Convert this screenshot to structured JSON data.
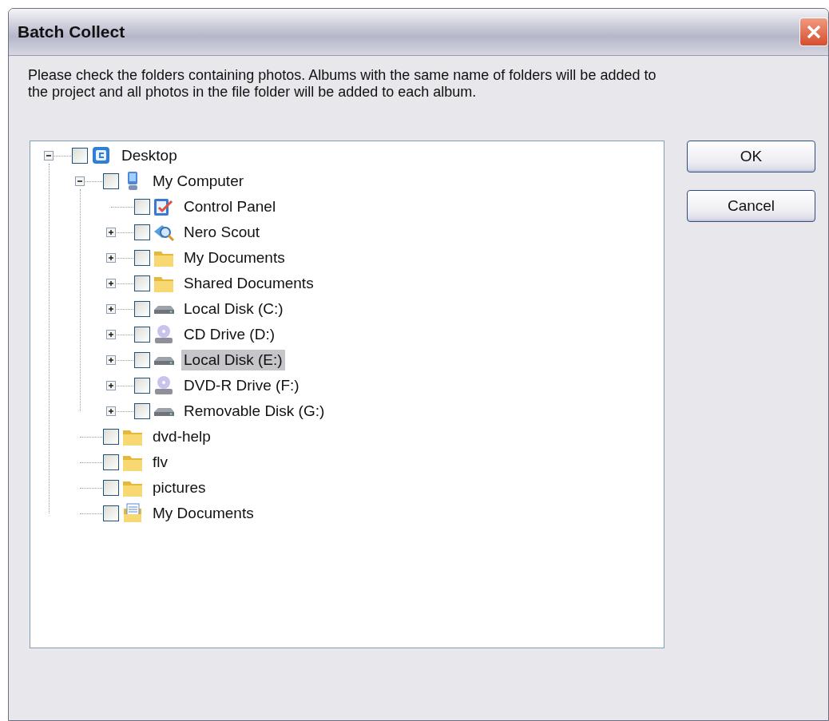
{
  "window": {
    "title": "Batch Collect"
  },
  "description": "Please check the folders containing photos. Albums with the same name of folders will be added to the project and all photos in the file folder will be added to each album.",
  "tree": [
    {
      "label": "Desktop",
      "kind": "desktop",
      "checked": false,
      "expanded": true,
      "selected": false,
      "children": [
        {
          "label": "My Computer",
          "kind": "computer",
          "checked": false,
          "expanded": true,
          "selected": false,
          "children": [
            {
              "label": "Control Panel",
              "kind": "panel",
              "checked": false,
              "selected": false
            },
            {
              "label": "Nero Scout",
              "kind": "search",
              "checked": false,
              "expanded": false,
              "selected": false
            },
            {
              "label": "My Documents",
              "kind": "folder",
              "checked": false,
              "expanded": false,
              "selected": false
            },
            {
              "label": "Shared Documents",
              "kind": "folder",
              "checked": false,
              "expanded": false,
              "selected": false
            },
            {
              "label": "Local Disk (C:)",
              "kind": "drive",
              "checked": false,
              "expanded": false,
              "selected": false
            },
            {
              "label": "CD Drive (D:)",
              "kind": "disc",
              "checked": false,
              "expanded": false,
              "selected": false
            },
            {
              "label": "Local Disk (E:)",
              "kind": "drive",
              "checked": false,
              "expanded": false,
              "selected": true
            },
            {
              "label": "DVD-R Drive (F:)",
              "kind": "disc",
              "checked": false,
              "expanded": false,
              "selected": false
            },
            {
              "label": "Removable Disk (G:)",
              "kind": "drive",
              "checked": false,
              "expanded": false,
              "selected": false
            }
          ]
        },
        {
          "label": "dvd-help",
          "kind": "folder",
          "checked": false,
          "selected": false
        },
        {
          "label": "flv",
          "kind": "folder",
          "checked": false,
          "selected": false
        },
        {
          "label": "pictures",
          "kind": "folder",
          "checked": false,
          "selected": false
        },
        {
          "label": "My Documents",
          "kind": "documents",
          "checked": false,
          "selected": false
        }
      ]
    }
  ],
  "buttons": [
    "OK",
    "Cancel"
  ]
}
